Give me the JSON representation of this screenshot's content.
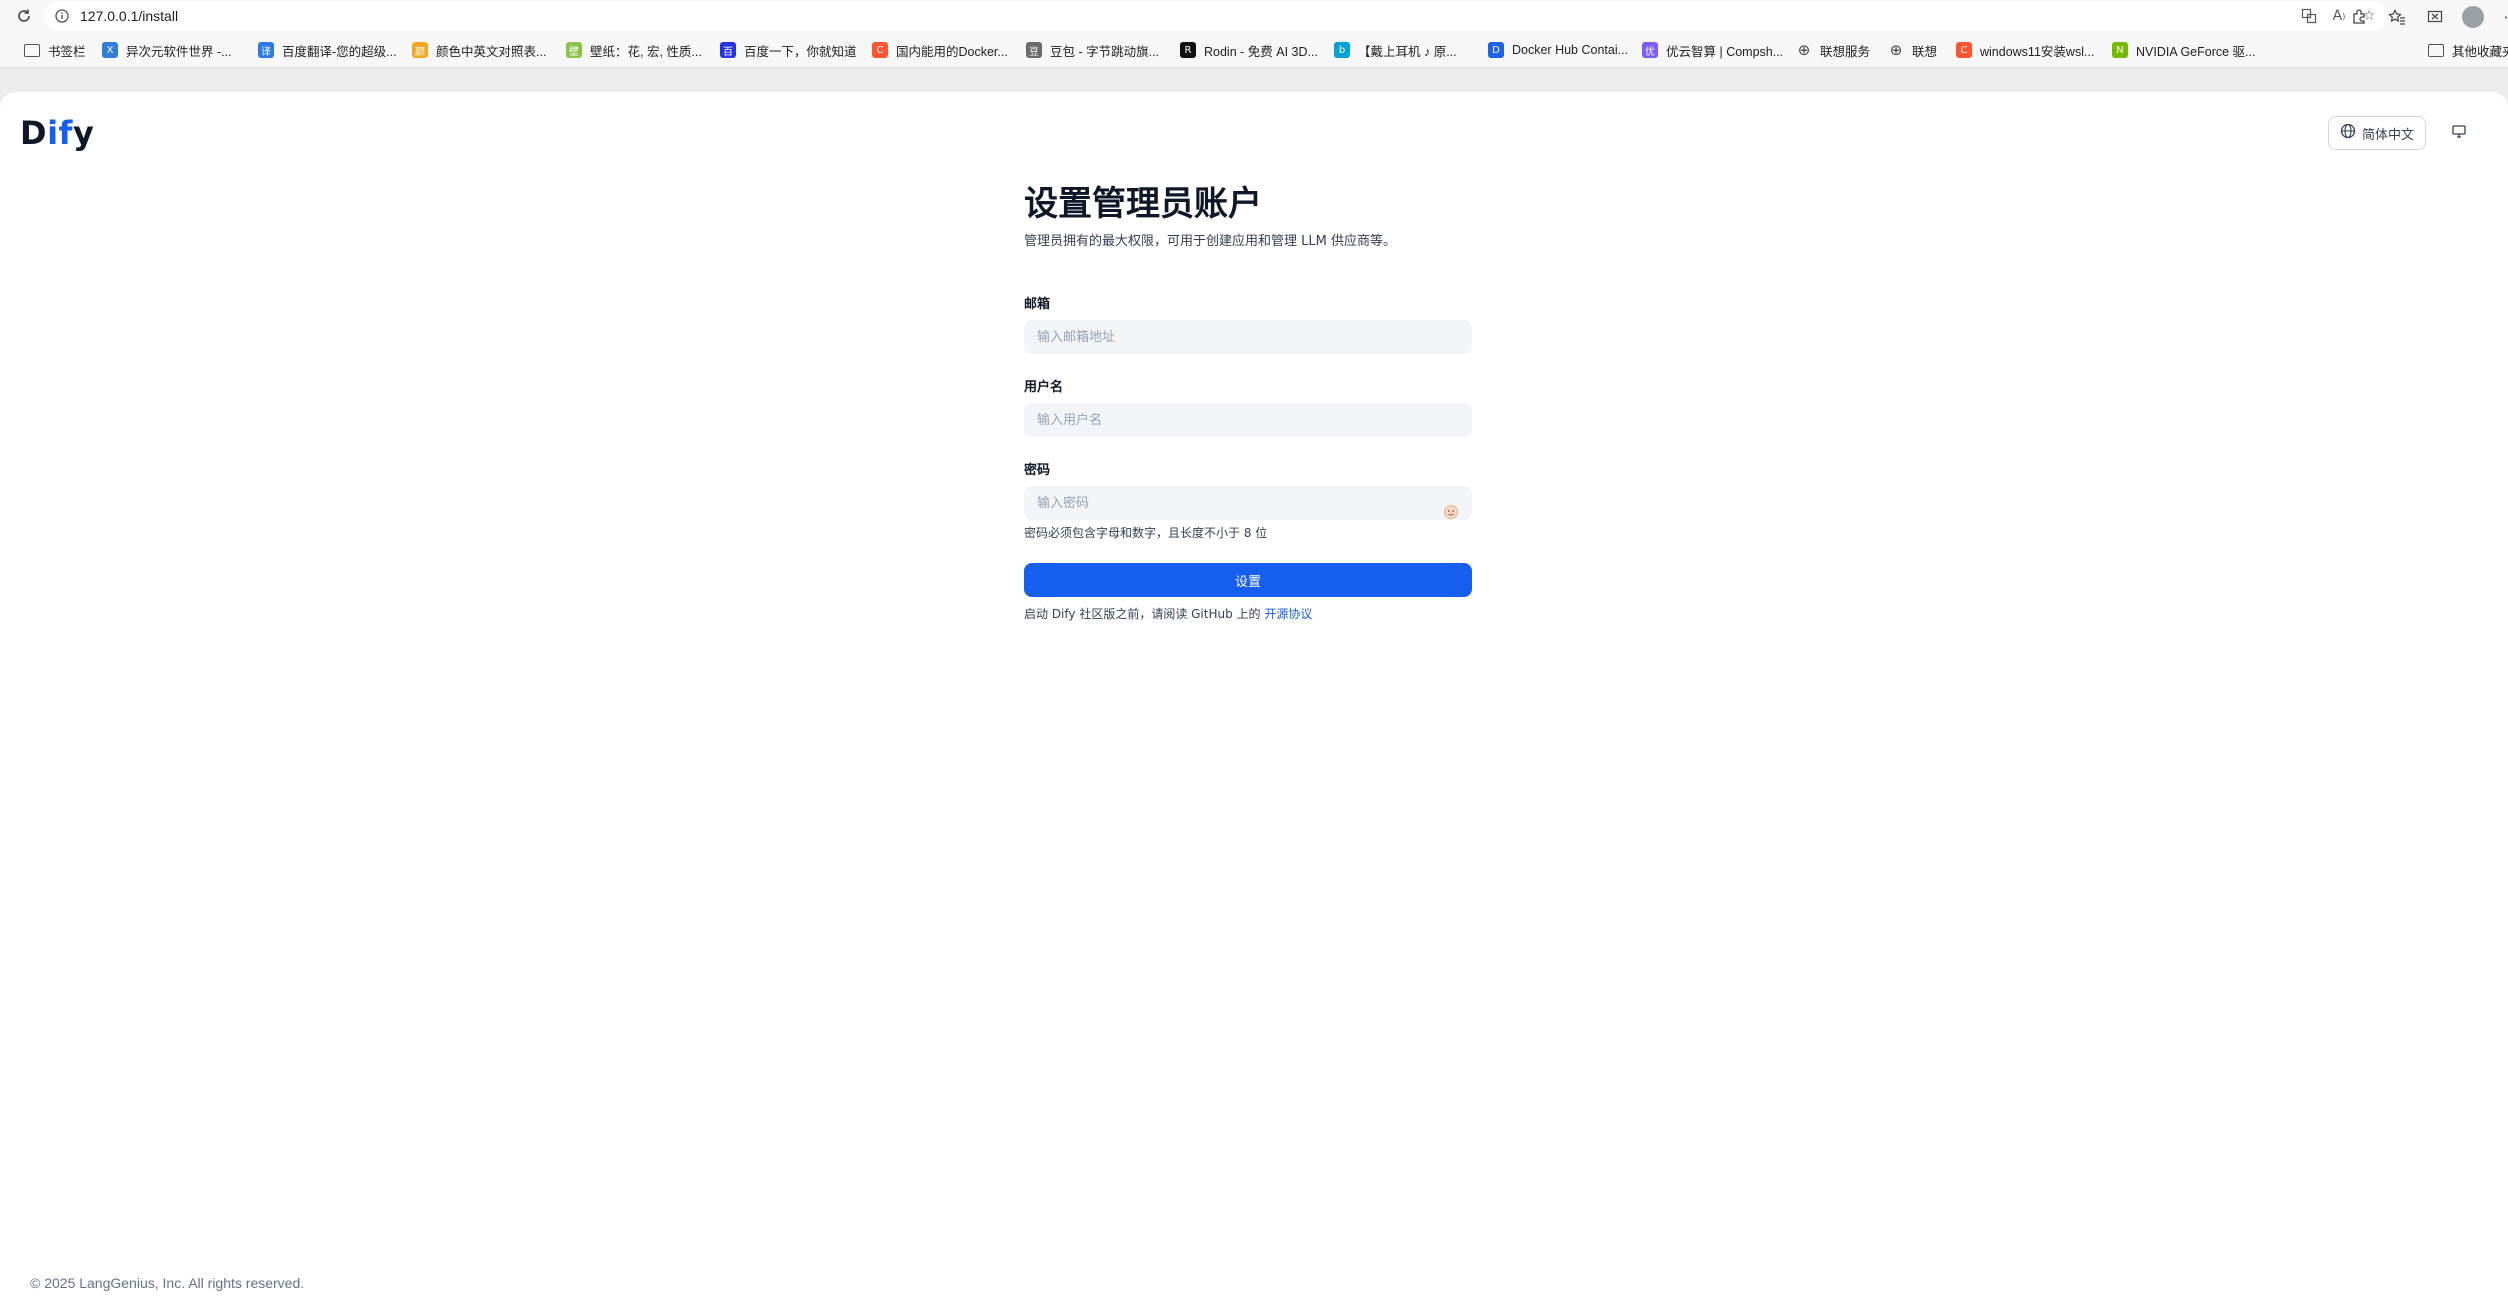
{
  "browser": {
    "url": "127.0.0.1/install",
    "bookmarks": [
      {
        "label": "书签栏",
        "icon": "folder-icon",
        "color": "#555555",
        "glyph": ""
      },
      {
        "label": "异次元软件世界 -...",
        "icon": "site-icon",
        "color": "#2f7fd8",
        "glyph": "X"
      },
      {
        "label": "百度翻译-您的超级...",
        "icon": "translate-icon",
        "color": "#2a7be4",
        "glyph": "译"
      },
      {
        "label": "颜色中英文对照表...",
        "icon": "site-icon",
        "color": "#f5a623",
        "glyph": "颜"
      },
      {
        "label": "壁纸：花, 宏, 性质...",
        "icon": "site-icon",
        "color": "#8bc34a",
        "glyph": "壁"
      },
      {
        "label": "百度一下，你就知道",
        "icon": "baidu-icon",
        "color": "#2932e1",
        "glyph": "百"
      },
      {
        "label": "国内能用的Docker...",
        "icon": "csdn-icon",
        "color": "#fc5531",
        "glyph": "C"
      },
      {
        "label": "豆包 - 字节跳动旗...",
        "icon": "doubao-icon",
        "color": "#6b6b6b",
        "glyph": "豆"
      },
      {
        "label": "Rodin - 免费 AI 3D...",
        "icon": "rodin-icon",
        "color": "#111111",
        "glyph": "R"
      },
      {
        "label": "【戴上耳机 ♪ 原...",
        "icon": "bilibili-icon",
        "color": "#00a1d6",
        "glyph": "b"
      },
      {
        "label": "Docker Hub Contai...",
        "icon": "docker-icon",
        "color": "#1d63ed",
        "glyph": "D"
      },
      {
        "label": "优云智算 | Compsh...",
        "icon": "site-icon",
        "color": "#7b5cff",
        "glyph": "优"
      },
      {
        "label": "联想服务",
        "icon": "globe-icon",
        "color": "#444444",
        "glyph": ""
      },
      {
        "label": "联想",
        "icon": "globe-icon",
        "color": "#444444",
        "glyph": ""
      },
      {
        "label": "windows11安装wsl...",
        "icon": "csdn-icon",
        "color": "#fc5531",
        "glyph": "C"
      },
      {
        "label": "NVIDIA GeForce 驱...",
        "icon": "nvidia-icon",
        "color": "#76b900",
        "glyph": "N"
      },
      {
        "label": "其他收藏夹",
        "icon": "folder-icon",
        "color": "#555555",
        "glyph": ""
      }
    ]
  },
  "header": {
    "logo_prefix": "D",
    "logo_highlight": "if",
    "logo_suffix": "y",
    "language": "简体中文"
  },
  "form": {
    "title": "设置管理员账户",
    "subtitle": "管理员拥有的最大权限，可用于创建应用和管理 LLM 供应商等。",
    "email_label": "邮箱",
    "email_placeholder": "输入邮箱地址",
    "email_value": "",
    "username_label": "用户名",
    "username_placeholder": "输入用户名",
    "username_value": "",
    "password_label": "密码",
    "password_placeholder": "输入密码",
    "password_value": "",
    "password_hint": "密码必须包含字母和数字，且长度不小于 8 位",
    "submit_label": "设置",
    "agreement_prefix": "启动 Dify 社区版之前，请阅读 GitHub 上的",
    "agreement_link": "开源协议"
  },
  "footer": {
    "copyright": "© 2025 LangGenius, Inc. All rights reserved."
  },
  "colors": {
    "accent": "#155eef",
    "input_bg": "#f2f4f7"
  }
}
